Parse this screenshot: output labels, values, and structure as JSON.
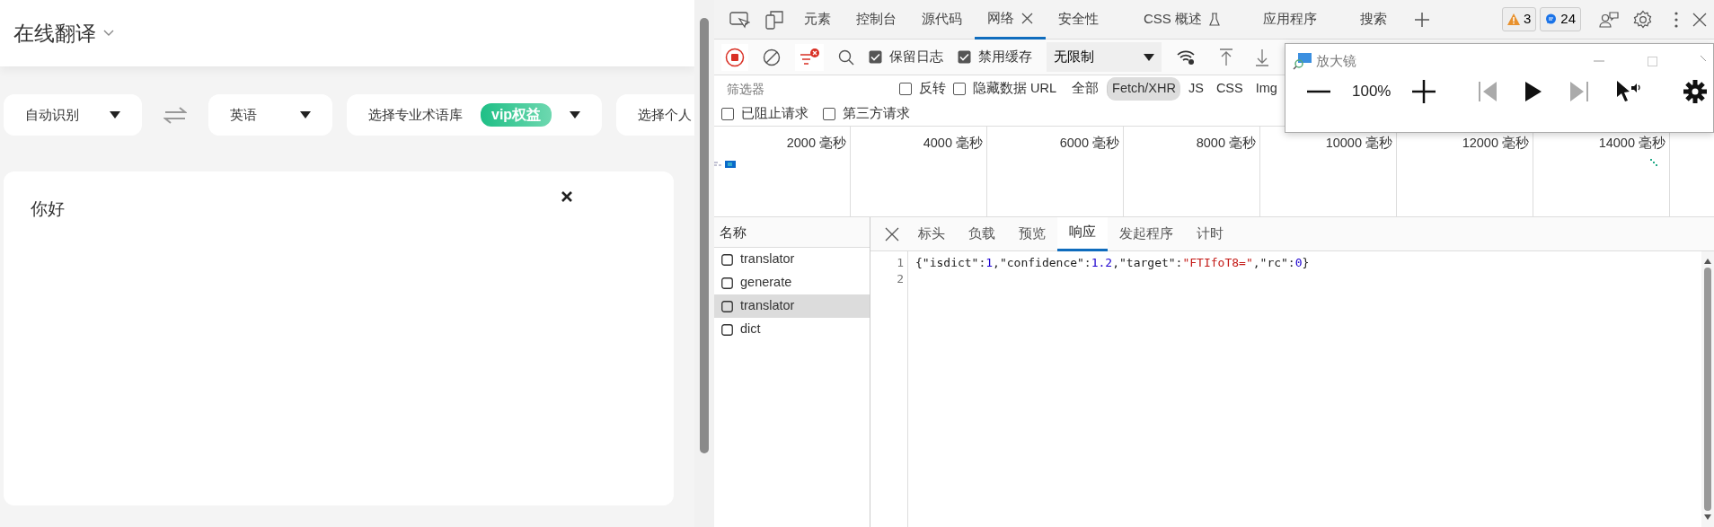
{
  "translator": {
    "title": "在线翻译",
    "selectors": [
      {
        "kind": "dropdown",
        "label": "自动识别"
      },
      {
        "kind": "swap"
      },
      {
        "kind": "dropdown",
        "label": "英语"
      },
      {
        "kind": "dropdown",
        "label": "选择专业术语库",
        "badge": "vip权益"
      },
      {
        "kind": "dropdown",
        "label": "选择个人"
      }
    ],
    "input": {
      "value": "你好"
    }
  },
  "devtools": {
    "tabs": [
      {
        "label": "元素",
        "kind": "tab",
        "selected": false
      },
      {
        "label": "控制台",
        "kind": "tab",
        "selected": false
      },
      {
        "label": "源代码",
        "kind": "tab",
        "selected": false
      },
      {
        "label": "网络",
        "kind": "closable",
        "selected": true
      },
      {
        "label": "安全性",
        "kind": "tab",
        "selected": false
      },
      {
        "label": "CSS 概述",
        "kind": "experimental",
        "selected": false
      },
      {
        "label": "应用程序",
        "kind": "tab",
        "selected": false
      },
      {
        "label": "搜索",
        "kind": "tab",
        "selected": false
      }
    ],
    "issues": [
      {
        "kind": "warning",
        "count": "3"
      },
      {
        "kind": "info",
        "count": "24"
      }
    ],
    "toolbar": {
      "checkboxes": [
        {
          "label": "保留日志",
          "checked": true
        },
        {
          "label": "禁用缓存",
          "checked": true
        }
      ],
      "throttling": "无限制"
    },
    "filter": {
      "placeholder": "筛选器",
      "options": [
        {
          "label": "反转",
          "checked": false
        },
        {
          "label": "隐藏数据 URL",
          "checked": false
        }
      ],
      "types": [
        {
          "label": "全部",
          "selected": false
        },
        {
          "label": "Fetch/XHR",
          "selected": true
        },
        {
          "label": "JS",
          "selected": false
        },
        {
          "label": "CSS",
          "selected": false
        },
        {
          "label": "Img",
          "selected": false
        }
      ],
      "extra_options": [
        {
          "label": "已阻止请求",
          "checked": false
        },
        {
          "label": "第三方请求",
          "checked": false
        }
      ]
    },
    "timeline": {
      "ticks": [
        "2000 毫秒",
        "4000 毫秒",
        "6000 毫秒",
        "8000 毫秒",
        "10000 毫秒",
        "12000 毫秒",
        "14000 毫秒"
      ]
    },
    "requests": {
      "header": "名称",
      "items": [
        {
          "name": "translator",
          "selected": false
        },
        {
          "name": "generate",
          "selected": false
        },
        {
          "name": "translator",
          "selected": true
        },
        {
          "name": "dict",
          "selected": false
        }
      ]
    },
    "detail": {
      "tabs": [
        {
          "label": "标头",
          "selected": false
        },
        {
          "label": "负载",
          "selected": false
        },
        {
          "label": "预览",
          "selected": false
        },
        {
          "label": "响应",
          "selected": true
        },
        {
          "label": "发起程序",
          "selected": false
        },
        {
          "label": "计时",
          "selected": false
        }
      ],
      "lines": [
        {
          "number": "1",
          "tokens": [
            {
              "kind": "plain",
              "text": "{\"isdict\":"
            },
            {
              "kind": "number",
              "text": "1"
            },
            {
              "kind": "plain",
              "text": ",\"confidence\":"
            },
            {
              "kind": "number",
              "text": "1.2"
            },
            {
              "kind": "plain",
              "text": ",\"target\":"
            },
            {
              "kind": "string",
              "text": "\"FTIfoT8=\""
            },
            {
              "kind": "plain",
              "text": ",\"rc\":"
            },
            {
              "kind": "number",
              "text": "0"
            },
            {
              "kind": "plain",
              "text": "}"
            }
          ]
        },
        {
          "number": "2"
        }
      ]
    }
  },
  "magnifier": {
    "title": "放大镜",
    "zoom": "100%"
  }
}
